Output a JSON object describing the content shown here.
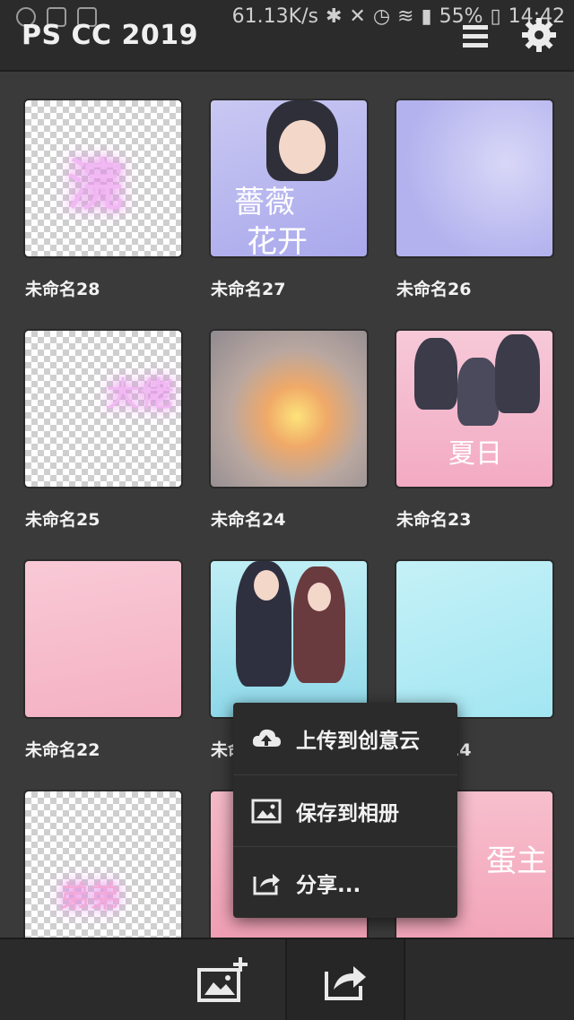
{
  "status": {
    "net_speed": "61.13K/s",
    "battery": "55%",
    "time": "14:42"
  },
  "header": {
    "title": "PS CC 2019"
  },
  "tiles": [
    {
      "name": "未命名28"
    },
    {
      "name": "未命名27"
    },
    {
      "name": "未命名26"
    },
    {
      "name": "未命名25"
    },
    {
      "name": "未命名24"
    },
    {
      "name": "未命名23"
    },
    {
      "name": "未命名22"
    },
    {
      "name": "未命名21"
    },
    {
      "name": "未命名14"
    },
    {
      "name": ""
    },
    {
      "name": ""
    },
    {
      "name": ""
    }
  ],
  "artwork_text": {
    "t28": "浣",
    "t27_line1": "薔薇",
    "t27_line2": "花开",
    "t25": "大佬",
    "t23": "夏日",
    "t_bottom_left": "弟弟",
    "t_bottom_right": "蛋主"
  },
  "context_menu": {
    "items": [
      {
        "label": "上传到创意云",
        "icon": "cloud-upload-icon"
      },
      {
        "label": "保存到相册",
        "icon": "image-icon"
      },
      {
        "label": "分享...",
        "icon": "share-icon"
      }
    ]
  },
  "bottom_bar": {
    "buttons": [
      {
        "icon": "add-image-icon"
      },
      {
        "icon": "share-icon"
      }
    ]
  },
  "colors": {
    "background": "#3a3a3a",
    "bar": "#2b2b2b",
    "accent_pink": "#f3b7cd",
    "accent_purple": "#b7b6ee",
    "accent_cyan": "#b8eef6"
  }
}
